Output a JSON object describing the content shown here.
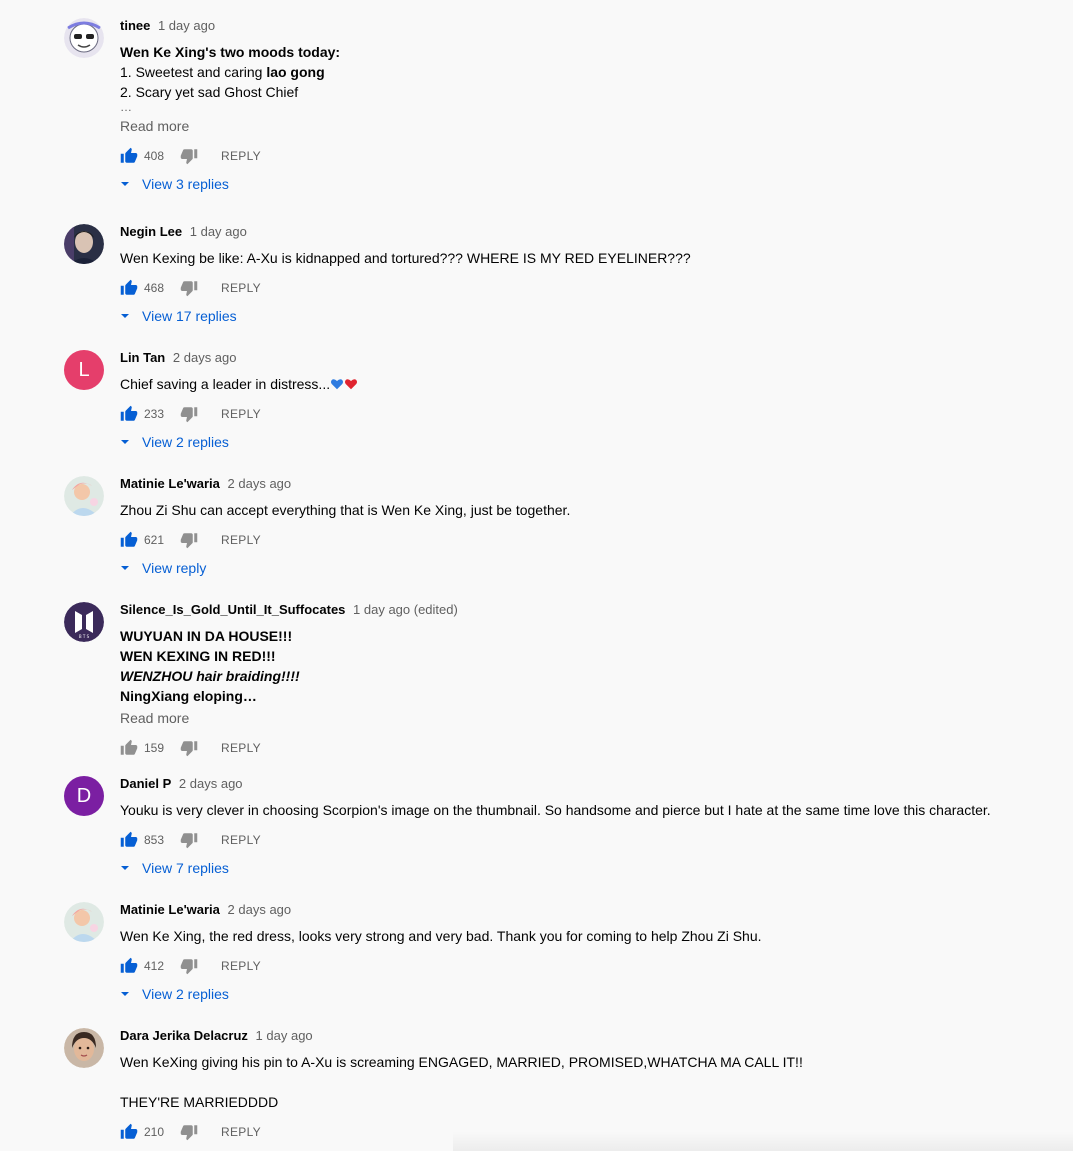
{
  "colors": {
    "background": "#f9f9f9",
    "like_active": "#065fd4",
    "link_blue": "#065fd4",
    "muted_text": "#606060"
  },
  "comments": [
    {
      "author": "tinee",
      "time": "1 day ago",
      "avatar": {
        "type": "image",
        "icon": "cartoon-sunglasses-avatar-icon"
      },
      "lines": [
        "Wen Ke Xing's two moods today:",
        "1. Sweetest and caring ",
        "lao gong",
        "2. Scary yet sad Ghost Chief",
        "…"
      ],
      "read_more": "Read more",
      "likes": "408",
      "reply_label": "REPLY",
      "replies_label": "View 3 replies"
    },
    {
      "author": "Negin Lee",
      "time": "1 day ago",
      "avatar": {
        "type": "image",
        "icon": "portrait-avatar-icon"
      },
      "lines": [
        "Wen Kexing be like: A-Xu is kidnapped and tortured??? WHERE IS MY RED EYELINER???"
      ],
      "likes": "468",
      "reply_label": "REPLY",
      "replies_label": "View 17 replies"
    },
    {
      "author": "Lin Tan",
      "time": "2 days ago",
      "avatar": {
        "type": "letter",
        "letter": "L",
        "color": "#e53e6b"
      },
      "lines": [
        "Chief saving a leader in distress..."
      ],
      "likes": "233",
      "reply_label": "REPLY",
      "replies_label": "View 2 replies"
    },
    {
      "author": "Matinie Le'waria",
      "time": "2 days ago",
      "avatar": {
        "type": "image",
        "icon": "pastel-photo-avatar-icon"
      },
      "lines": [
        "Zhou Zi Shu can accept everything that is Wen Ke Xing, just be together."
      ],
      "likes": "621",
      "reply_label": "REPLY",
      "replies_label": "View reply"
    },
    {
      "author": "Silence_Is_Gold_Until_It_Suffocates",
      "time": "1 day ago (edited)",
      "avatar": {
        "type": "image",
        "icon": "bts-logo-avatar-icon"
      },
      "lines": [
        "WUYUAN IN DA HOUSE!!!",
        "WEN KEXING IN RED!!!",
        "WENZHOU hair braiding!!!!",
        "NingXiang eloping…"
      ],
      "read_more": "Read more",
      "likes": "159",
      "reply_label": "REPLY"
    },
    {
      "author": "Daniel P",
      "time": "2 days ago",
      "avatar": {
        "type": "letter",
        "letter": "D",
        "color": "#7b1fa2"
      },
      "lines": [
        "Youku is very clever in choosing Scorpion's image on the thumbnail. So handsome and pierce but I hate at the same time love this character."
      ],
      "likes": "853",
      "reply_label": "REPLY",
      "replies_label": "View 7 replies"
    },
    {
      "author": "Matinie Le'waria",
      "time": "2 days ago",
      "avatar": {
        "type": "image",
        "icon": "pastel-photo-avatar-icon"
      },
      "lines": [
        "Wen Ke Xing, the red dress, looks very strong and very bad. Thank you for coming to help Zhou Zi Shu."
      ],
      "likes": "412",
      "reply_label": "REPLY",
      "replies_label": "View 2 replies"
    },
    {
      "author": "Dara Jerika Delacruz",
      "time": "1 day ago",
      "avatar": {
        "type": "image",
        "icon": "selfie-avatar-icon"
      },
      "lines": [
        "Wen KeXing giving his pin to A-Xu is screaming ENGAGED, MARRIED, PROMISED,WHATCHA MA CALL IT!!",
        "THEY'RE MARRIEDDDD"
      ],
      "likes": "210",
      "reply_label": "REPLY"
    }
  ]
}
